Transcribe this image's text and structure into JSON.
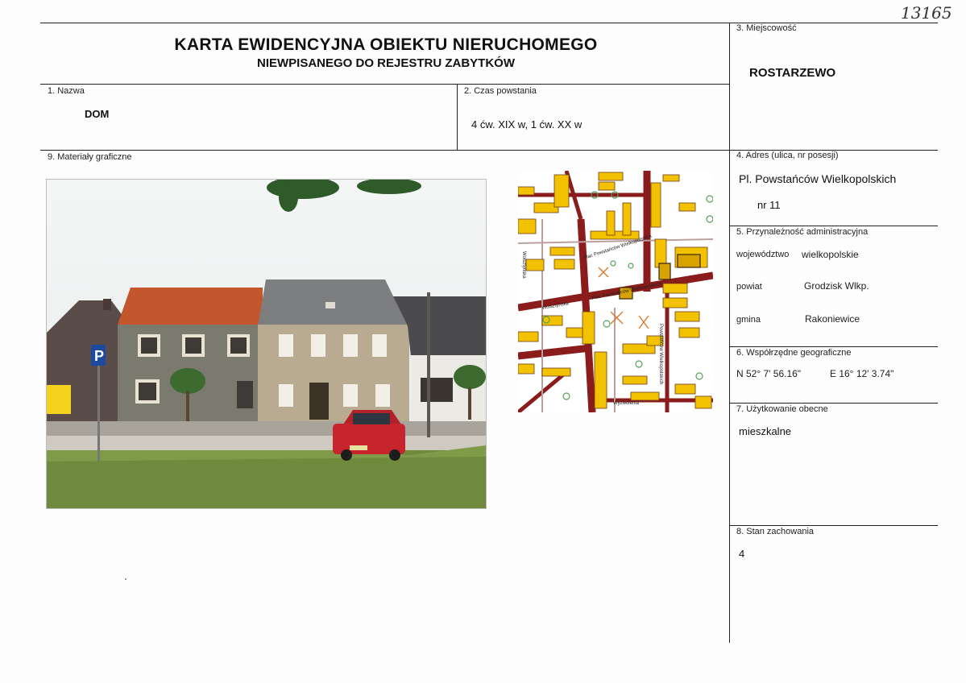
{
  "document_number": "13165",
  "header": {
    "title": "KARTA EWIDENCYJNA OBIEKTU NIERUCHOMEGO",
    "subtitle": "NIEWPISANEGO DO REJESTRU ZABYTKÓW"
  },
  "fields": {
    "miejscowosc": {
      "label": "3. Miejscowość",
      "value": "ROSTARZEWO"
    },
    "nazwa": {
      "label": "1. Nazwa",
      "value": "DOM"
    },
    "czas_powstania": {
      "label": "2. Czas powstania",
      "value": "4 ćw. XIX w,  1 ćw. XX w"
    },
    "materialy": {
      "label": "9. Materiały graficzne"
    },
    "adres": {
      "label": "4. Adres (ulica, nr posesji)",
      "street": "Pl. Powstańców Wielkopolskich",
      "number": "nr   11"
    },
    "przynaleznosc": {
      "label": "5. Przynależność administracyjna",
      "wojewodztwo_label": "województwo",
      "wojewodztwo": "wielkopolskie",
      "powiat_label": "powiat",
      "powiat": "Grodzisk Wlkp.",
      "gmina_label": "gmina",
      "gmina": "Rakoniewice"
    },
    "wspolrzedne": {
      "label": "6. Współrzędne geograficzne",
      "n": "N  52° 7' 56.16\"",
      "e": "E 16° 12' 3.74\""
    },
    "uzytkowanie": {
      "label": "7. Użytkowanie obecne",
      "value": "mieszkalne"
    },
    "stan": {
      "label": "8. Stan zachowania",
      "value": "4"
    }
  },
  "map": {
    "street_labels": [
      "Plac Powstańców Wielkopolskich",
      "Plac Powstańców Wielkopolskich",
      "Wolsztyńska",
      "Wolsztyńska",
      "Powstańców Wielkopolskich",
      "Wyzwolenia"
    ]
  },
  "photo": {
    "sign_label": "P"
  },
  "colors": {
    "building": "#f2c200",
    "building_outline": "#6b3a1a",
    "road": "#8b1c1c",
    "tree_symbol": "#52a35a"
  }
}
